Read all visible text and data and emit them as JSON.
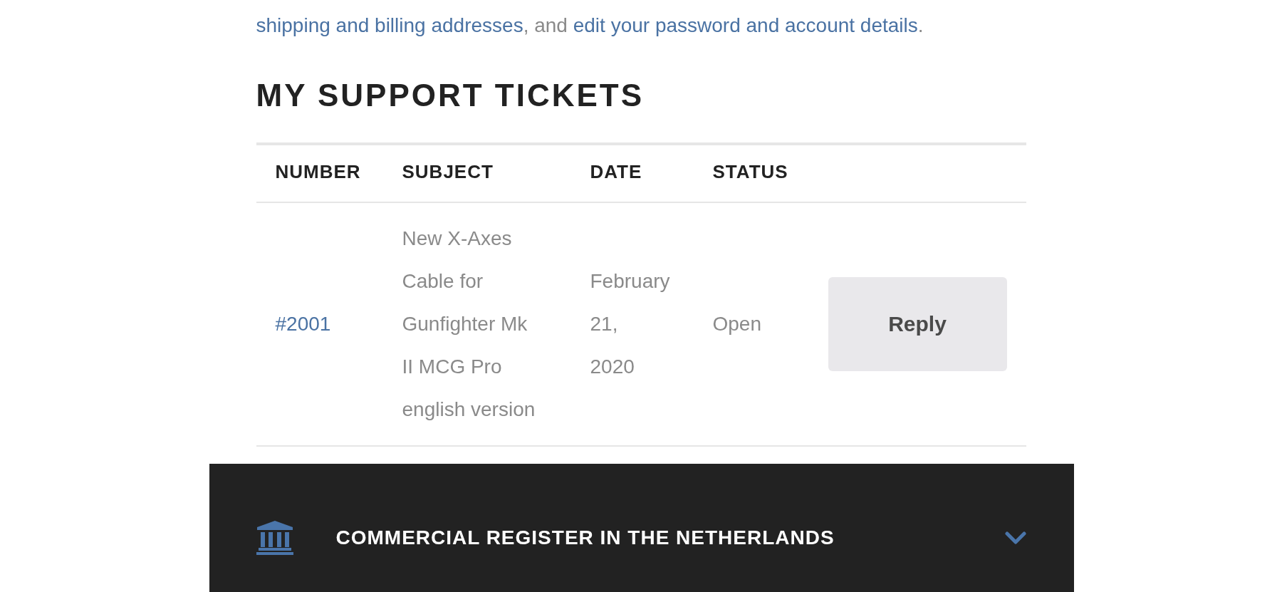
{
  "intro": {
    "segments": [
      {
        "kind": "link",
        "text": "shipping and billing addresses"
      },
      {
        "kind": "text",
        "text": ", and "
      },
      {
        "kind": "link",
        "text": "edit your password and account details"
      },
      {
        "kind": "text",
        "text": "."
      }
    ]
  },
  "heading": "MY SUPPORT TICKETS",
  "tickets_table": {
    "columns": [
      "NUMBER",
      "SUBJECT",
      "DATE",
      "STATUS"
    ],
    "rows": [
      {
        "number": "#2001",
        "subject": "New X-Axes Cable for Gunfighter Mk II MCG Pro english version",
        "date": "February 21, 2020",
        "status": "Open",
        "action": "Reply"
      }
    ]
  },
  "footer_section": {
    "title": "COMMERCIAL REGISTER IN THE NETHERLANDS",
    "expanded": false
  }
}
